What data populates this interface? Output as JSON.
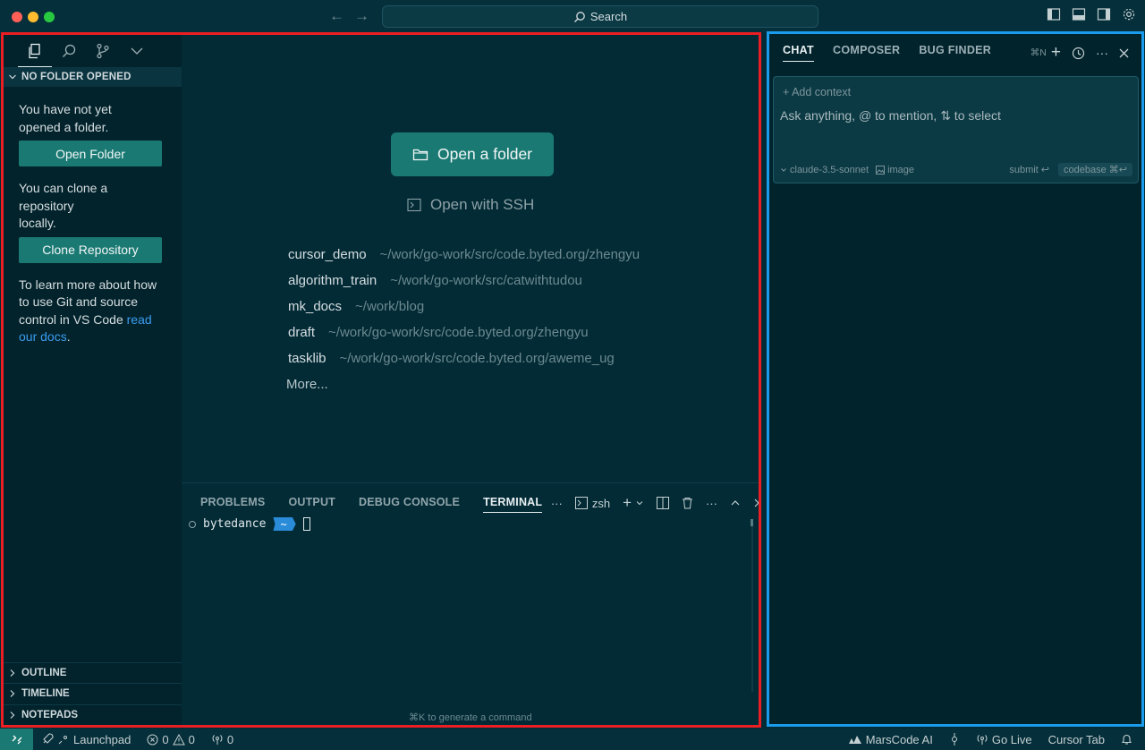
{
  "titlebar": {
    "search_label": "Search"
  },
  "sidebar": {
    "section_title": "NO FOLDER OPENED",
    "not_opened_text": "You have not yet opened a folder.",
    "open_folder_label": "Open Folder",
    "clone_text": "You can clone a repository locally.",
    "clone_label": "Clone Repository",
    "learn_text": "To learn more about how to use Git and source control in VS Code ",
    "learn_link": "read our docs",
    "learn_end": ".",
    "bottom_sections": [
      "OUTLINE",
      "TIMELINE",
      "NOTEPADS"
    ]
  },
  "welcome": {
    "open_folder_label": "Open a folder",
    "open_ssh_label": "Open with SSH",
    "recent": [
      {
        "name": "cursor_demo",
        "path": "~/work/go-work/src/code.byted.org/zhengyu"
      },
      {
        "name": "algorithm_train",
        "path": "~/work/go-work/src/catwithtudou"
      },
      {
        "name": "mk_docs",
        "path": "~/work/blog"
      },
      {
        "name": "draft",
        "path": "~/work/go-work/src/code.byted.org/zhengyu"
      },
      {
        "name": "tasklib",
        "path": "~/work/go-work/src/code.byted.org/aweme_ug"
      }
    ],
    "more_label": "More..."
  },
  "panel": {
    "tabs": [
      "PROBLEMS",
      "OUTPUT",
      "DEBUG CONSOLE",
      "TERMINAL"
    ],
    "active_tab": "TERMINAL",
    "shell": "zsh",
    "prompt_user": "bytedance",
    "prompt_dir": "~",
    "hint": "⌘K to generate a command"
  },
  "chat": {
    "tabs": [
      "CHAT",
      "COMPOSER",
      "BUG FINDER"
    ],
    "active_tab": "CHAT",
    "new_shortcut": "⌘N",
    "add_context": "Add context",
    "placeholder": "Ask anything, @ to mention, ⇅ to select",
    "model": "claude-3.5-sonnet",
    "image_label": "image",
    "submit_label": "submit",
    "codebase_label": "codebase ⌘↩"
  },
  "status": {
    "launchpad": "Launchpad",
    "errors": "0",
    "warnings": "0",
    "ports": "0",
    "marscode": "MarsCode AI",
    "go_live": "Go Live",
    "cursor_tab": "Cursor Tab"
  },
  "colors": {
    "accent_teal": "#1a7a73",
    "frame_red": "#ea1e23",
    "frame_blue": "#1b9bec",
    "badge_blue": "#2a8cd9"
  }
}
